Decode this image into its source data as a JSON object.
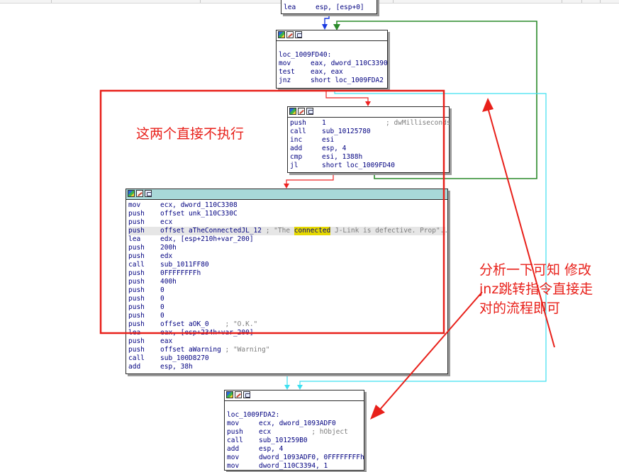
{
  "nodes": {
    "top": {
      "lines": [
        {
          "op": "lea",
          "args": "esp, [esp+0]"
        }
      ]
    },
    "n1": {
      "label": "loc_1009FD40:",
      "lines": [
        {
          "op": "mov",
          "args": "eax, dword_110C3390"
        },
        {
          "op": "test",
          "args": "eax, eax"
        },
        {
          "op": "jnz",
          "args": "short loc_1009FDA2"
        }
      ]
    },
    "n2": {
      "lines": [
        {
          "op": "push",
          "args": "1",
          "comment": "; dwMilliseconds"
        },
        {
          "op": "call",
          "args": "sub_10125780"
        },
        {
          "op": "inc",
          "args": "esi"
        },
        {
          "op": "add",
          "args": "esp, 4"
        },
        {
          "op": "cmp",
          "args": "esi, 1388h"
        },
        {
          "op": "jl",
          "args": "short loc_1009FD40"
        }
      ]
    },
    "n3": {
      "lines": [
        {
          "op": "mov",
          "args": "ecx, dword_110C3308"
        },
        {
          "op": "push",
          "args": "offset unk_110C330C"
        },
        {
          "op": "push",
          "args": "ecx"
        },
        {
          "op": "push",
          "args": "offset aTheConnectedJL_12 ",
          "c1": "; \"The ",
          "hl": "connected",
          "c2": " J-Link is defective. Prop\".."
        },
        {
          "op": "lea",
          "args": "edx, [esp+210h+var_200]"
        },
        {
          "op": "push",
          "args": "200h"
        },
        {
          "op": "push",
          "args": "edx"
        },
        {
          "op": "call",
          "args": "sub_1011FF80"
        },
        {
          "op": "push",
          "args": "0FFFFFFFFh"
        },
        {
          "op": "push",
          "args": "400h"
        },
        {
          "op": "push",
          "args": "0"
        },
        {
          "op": "push",
          "args": "0"
        },
        {
          "op": "push",
          "args": "0"
        },
        {
          "op": "push",
          "args": "0"
        },
        {
          "op": "push",
          "args": "offset aOK_0    ",
          "comment": "; \"O.K.\""
        },
        {
          "op": "lea",
          "args": "eax, [esp+234h+var_200]"
        },
        {
          "op": "push",
          "args": "eax"
        },
        {
          "op": "push",
          "args": "offset aWarning ",
          "comment": "; \"Warning\""
        },
        {
          "op": "call",
          "args": "sub_100D8270"
        },
        {
          "op": "add",
          "args": "esp, 38h"
        }
      ]
    },
    "n4": {
      "label": "loc_1009FDA2:",
      "lines": [
        {
          "op": "mov",
          "args": "ecx, dword_1093ADF0"
        },
        {
          "op": "push",
          "args": "ecx",
          "comment": "          ; hObject"
        },
        {
          "op": "call",
          "args": "sub_101259B0"
        },
        {
          "op": "add",
          "args": "esp, 4"
        },
        {
          "op": "mov",
          "args": "dword_1093ADF0, 0FFFFFFFFh"
        },
        {
          "op": "mov",
          "args": "dword_110C3394, 1"
        }
      ]
    }
  },
  "annotations": {
    "left": "这两个直接不执行",
    "right_line1": "分析一下可知 修改",
    "right_line2": "jnz跳转指令直接走",
    "right_line3": "对的流程即可"
  },
  "colors": {
    "annotation": "#e8201a",
    "edge_true": "#2a8a2a",
    "edge_false": "#e22",
    "edge_jump": "#3de0f0",
    "edge_seq": "#1a3ae0"
  }
}
